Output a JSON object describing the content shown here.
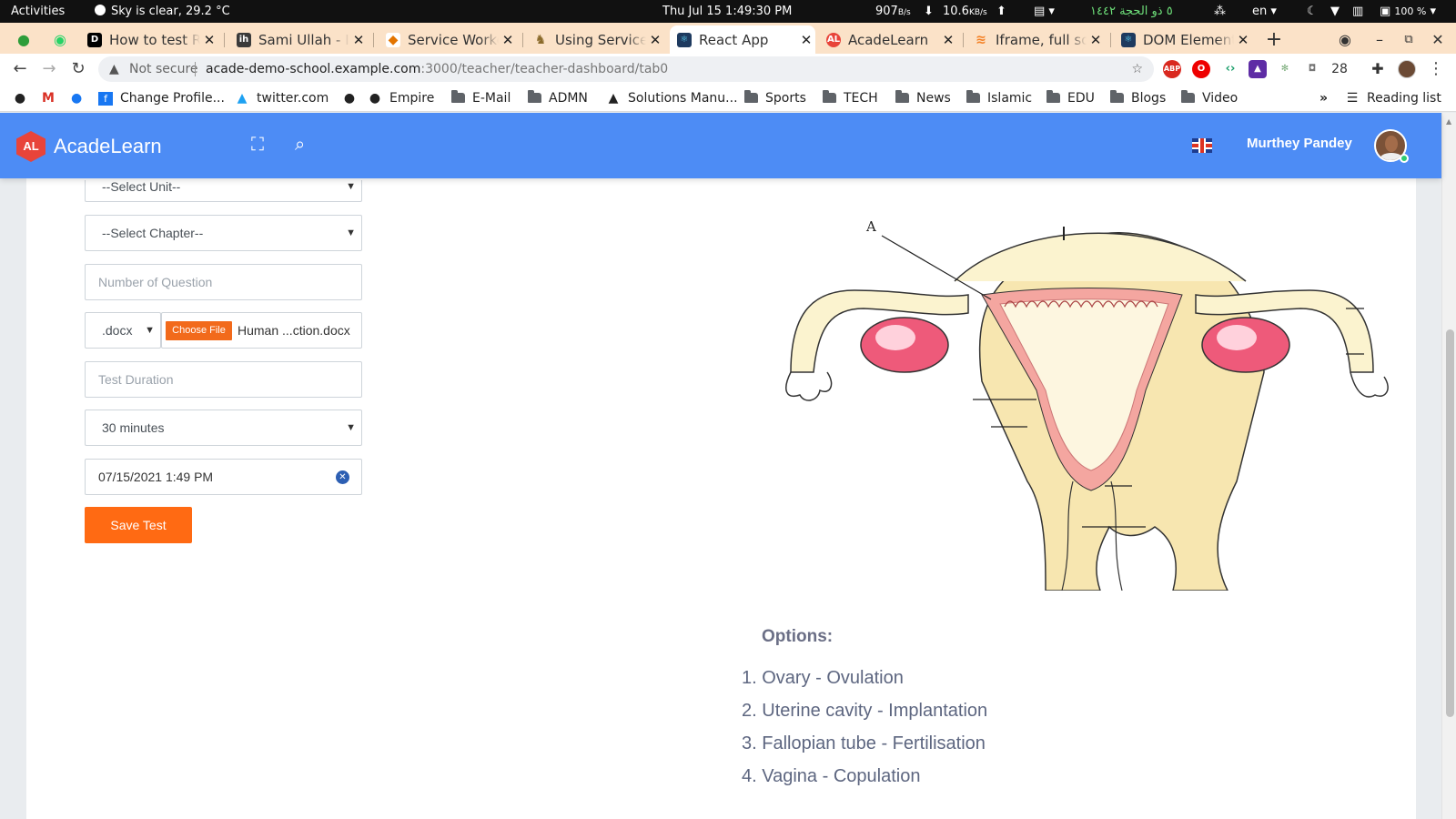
{
  "system_bar": {
    "activities": "Activities",
    "weather": "Sky is clear, 29.2 °C",
    "clock": "Thu Jul 15  1:49:30 PM",
    "net_up": "907",
    "net_up_unit": "B/s",
    "net_down": "10.6",
    "net_down_unit": "KB/s",
    "hijri_date": "٥ ذو الحجة ١٤٤٢",
    "lang": "en",
    "battery": "100 %"
  },
  "tabs": [
    {
      "label": "How to test RE",
      "favicon": "dev-icon",
      "color": "#000000"
    },
    {
      "label": "Sami Ullah - In",
      "favicon": "ih-icon",
      "color": "#3a3a3a"
    },
    {
      "label": "Service Worke",
      "favicon": "service-icon",
      "color": "#e37400"
    },
    {
      "label": "Using Service",
      "favicon": "mdn-icon",
      "color": "#8a6a2a"
    },
    {
      "label": "React App",
      "favicon": "react-icon",
      "color": "#1e3a5f"
    },
    {
      "label": "AcadeLearn",
      "favicon": "acadelearn-icon",
      "color": "#e8443a"
    },
    {
      "label": "Iframe, full scr",
      "favicon": "stackoverflow-icon",
      "color": "#f48024"
    },
    {
      "label": "DOM Element",
      "favicon": "react-icon",
      "color": "#1e3a5f"
    }
  ],
  "active_tab_index": 4,
  "address": {
    "security": "Not secure",
    "host": "acade-demo-school.example.com",
    "path": ":3000/teacher/teacher-dashboard/tab0",
    "ext_count": "28"
  },
  "bookmarks": [
    {
      "label": "Change Profile...",
      "icon": "facebook-page-icon"
    },
    {
      "label": "twitter.com",
      "icon": "twitter-icon"
    },
    {
      "label": "Empire",
      "icon": "globe-icon"
    },
    {
      "label": "E-Mail",
      "icon": "folder-icon"
    },
    {
      "label": "ADMN",
      "icon": "folder-icon"
    },
    {
      "label": "Solutions Manu...",
      "icon": "triangle-icon"
    },
    {
      "label": "Sports",
      "icon": "folder-icon"
    },
    {
      "label": "TECH",
      "icon": "folder-icon"
    },
    {
      "label": "News",
      "icon": "folder-icon"
    },
    {
      "label": "Islamic",
      "icon": "folder-icon"
    },
    {
      "label": "EDU",
      "icon": "folder-icon"
    },
    {
      "label": "Blogs",
      "icon": "folder-icon"
    },
    {
      "label": "Video",
      "icon": "folder-icon"
    }
  ],
  "reading_list": "Reading list",
  "overflow": "»",
  "header": {
    "logo_text": "AL",
    "brand": "AcadeLearn",
    "user_name": "Murthey Pandey",
    "color": "#4d8cf5"
  },
  "form": {
    "unit_select": "--Select Unit--",
    "chapter_select": "--Select Chapter--",
    "question_count_placeholder": "Number of Question",
    "file_type": ".docx",
    "choose_file": "Choose File",
    "file_name": "Human ...ction.docx",
    "duration_placeholder": "Test Duration",
    "duration_select": "30 minutes",
    "datetime": "07/15/2021 1:49 PM",
    "save_button": "Save Test"
  },
  "question": {
    "diagram_label": "A",
    "options_title": "Options:",
    "options": [
      "Ovary - Ovulation",
      "Uterine cavity - Implantation",
      "Fallopian tube - Fertilisation",
      "Vagina - Copulation"
    ],
    "option_numbers": [
      "1.",
      "2.",
      "3.",
      "4."
    ]
  }
}
